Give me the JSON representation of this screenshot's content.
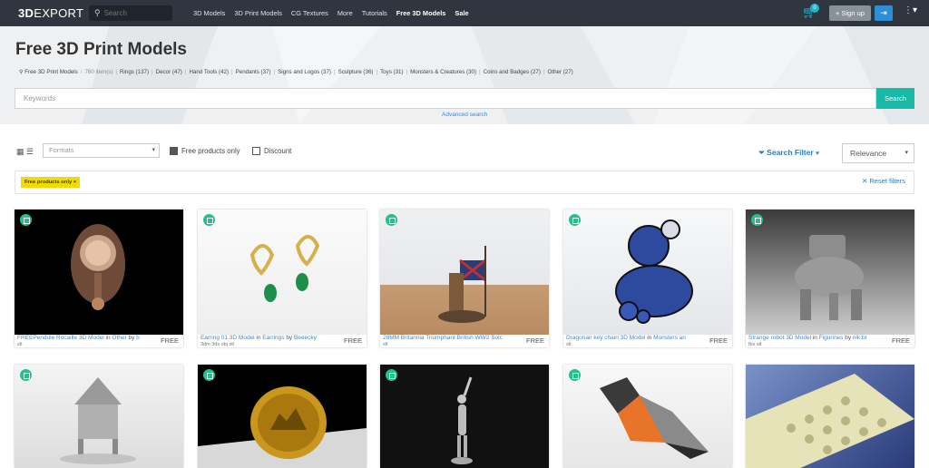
{
  "header": {
    "logo_bold": "3D",
    "logo_thin": "EXPORT",
    "search_placeholder": "Search",
    "nav": [
      "3D Models",
      "3D Print Models",
      "CG Textures",
      "More",
      "Tutorials",
      "Free 3D Models",
      "Sale"
    ],
    "cart_count": "0",
    "signup_label": "Sign up"
  },
  "page": {
    "title": "Free 3D Print Models",
    "breadcrumb": {
      "root": "Free 3D Print Models",
      "count": "760 item(s)",
      "items": [
        "Rings (137)",
        "Decor (47)",
        "Hand Tools (42)",
        "Pendants (37)",
        "Signs and Logos (37)",
        "Sculpture (36)",
        "Toys (31)",
        "Monsters & Creatures (30)",
        "Coins and Badges (27)",
        "Other (27)"
      ]
    },
    "keyword_placeholder": "Keywords",
    "search_label": "Search",
    "advanced_search": "Advanced search"
  },
  "toolbar": {
    "formats_placeholder": "Formats",
    "free_only_label": "Free products only",
    "discount_label": "Discount",
    "search_filter_label": "Search Filter",
    "sort_value": "Relevance",
    "active_chip": "Free products only ×",
    "reset_label": "Reset filters"
  },
  "products": [
    {
      "title": "FREEPendule Rocaille 3D Model",
      "in": " in ",
      "category": "Other",
      "by": " by ",
      "author": "b",
      "formats": "stl",
      "price": "FREE"
    },
    {
      "title": "Earring 01 3D Model",
      "in": " in ",
      "category": "Earrings",
      "by": " by ",
      "author": "Beeecky",
      "formats": "3dm 3ds obj stl",
      "price": "FREE"
    },
    {
      "title": "28MM Britannia Triumphant British WW2 Solc",
      "in": "",
      "category": "",
      "by": "",
      "author": "",
      "formats": "stl",
      "price": "FREE"
    },
    {
      "title": "Dragonair key chain 3D Model",
      "in": " in ",
      "category": "Monsters an",
      "by": "",
      "author": "",
      "formats": "stl",
      "price": "FREE"
    },
    {
      "title": "Strange robot 3D Model",
      "in": " in ",
      "category": "Figurines",
      "by": " by ",
      "author": "nik.br",
      "formats": "fbx stl",
      "price": "FREE"
    }
  ],
  "colors": {
    "accent": "#19b9a7",
    "link": "#3b8ad9",
    "topbar": "#2f3640",
    "badge": "#26c08d",
    "chip": "#f2dc00"
  }
}
